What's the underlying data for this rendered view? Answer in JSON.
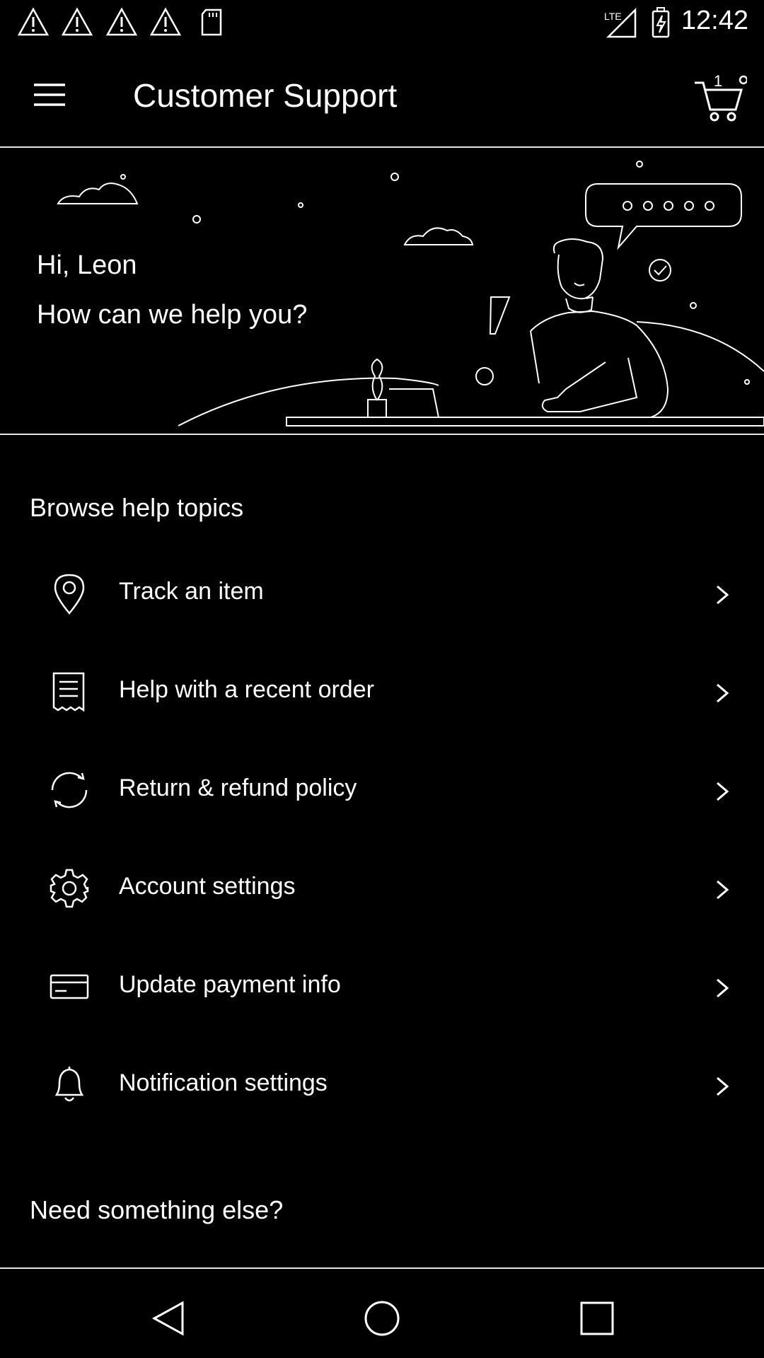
{
  "status_bar": {
    "time": "12:42",
    "network": "LTE",
    "notification_icons": [
      "warning-icon",
      "warning-icon",
      "warning-icon",
      "warning-icon",
      "sd-card-icon"
    ]
  },
  "header": {
    "title": "Customer Support",
    "cart_count": "1"
  },
  "hero": {
    "greeting": "Hi, Leon",
    "subtitle": "How can we help you?"
  },
  "browse": {
    "title": "Browse help topics",
    "topics": [
      {
        "label": "Track an item",
        "icon": "location-pin-icon"
      },
      {
        "label": "Help with a recent order",
        "icon": "receipt-icon"
      },
      {
        "label": "Return & refund policy",
        "icon": "refresh-icon"
      },
      {
        "label": "Account settings",
        "icon": "gear-icon"
      },
      {
        "label": "Update payment info",
        "icon": "credit-card-icon"
      },
      {
        "label": "Notification settings",
        "icon": "bell-icon"
      }
    ]
  },
  "more": {
    "title": "Need something else?"
  },
  "colors": {
    "background": "#000000",
    "outline": "#ffffff",
    "divider": "#e6e6e6"
  }
}
